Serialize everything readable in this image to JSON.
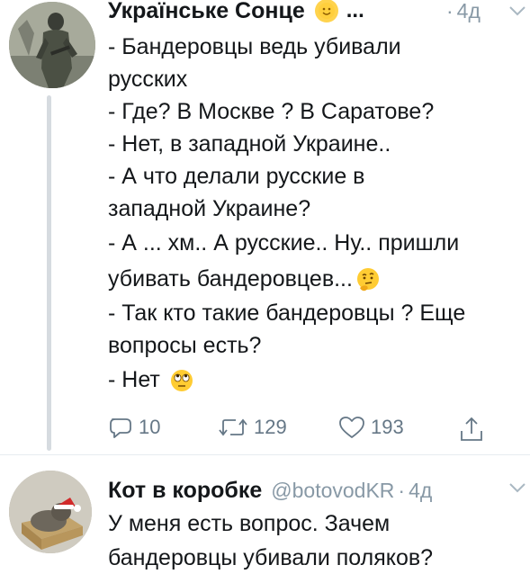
{
  "tweet1": {
    "author_name": "Українське Сонце",
    "ellipsis": "...",
    "time": "4д",
    "time_dot": "·",
    "lines": [
      "- Бандеровцы ведь убивали",
      "русских",
      "- Где? В Москве ? В Саратове?",
      "- Нет, в западной Украине..",
      "- А что делали русские в",
      "западной Украине?",
      "- А ... хм.. А русские.. Ну.. пришли",
      "убивать бандеровцев...",
      "- Так кто такие бандеровцы ? Еще",
      "вопросы есть?",
      "- Нет"
    ],
    "actions": {
      "reply_count": "10",
      "retweet_count": "129",
      "like_count": "193"
    },
    "icons": [
      "sun-emoji-icon",
      "thinking-face-emoji-icon",
      "rolling-eyes-emoji-icon",
      "reply-icon",
      "retweet-icon",
      "like-icon",
      "share-icon",
      "chevron-down-icon"
    ]
  },
  "tweet2": {
    "author_name": "Кот в коробке",
    "handle": "@botovodKR",
    "time": "4д",
    "time_dot": "·",
    "lines": [
      "У меня есть вопрос. Зачем",
      "бандеровцы убивали поляков?"
    ]
  },
  "colors": {
    "text": "#14171a",
    "secondary": "#8899a6",
    "action_gray": "#657786",
    "thread_line": "#d6dbe0"
  }
}
